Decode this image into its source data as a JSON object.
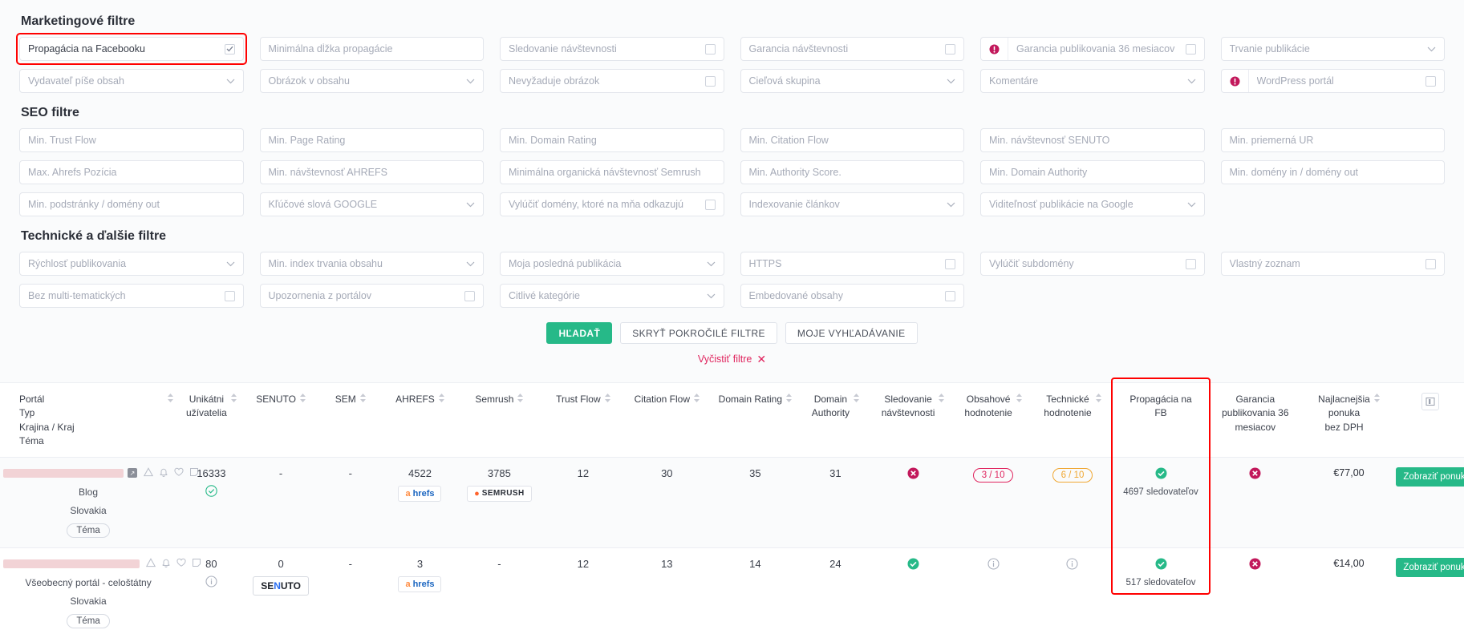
{
  "sections": {
    "marketing": {
      "title": "Marketingové filtre",
      "rows": [
        [
          {
            "name": "propagacia-na-facebooku",
            "label": "Propagácia na Facebooku",
            "type": "checkbox",
            "checked": true,
            "filled": true,
            "highlight": true
          },
          {
            "name": "minimalna-dlzka-propagacie",
            "label": "Minimálna dĺžka propagácie",
            "type": "text"
          },
          {
            "name": "sledovanie-navstevnosti",
            "label": "Sledovanie návštevnosti",
            "type": "checkbox",
            "checked": false
          },
          {
            "name": "garancia-navstevnosti",
            "label": "Garancia návštevnosti",
            "type": "checkbox",
            "checked": false
          },
          {
            "name": "garancia-publikovania-36-mesiacov",
            "label": "Garancia publikovania 36 mesiacov",
            "type": "checkbox",
            "checked": false,
            "badge": "premium"
          },
          {
            "name": "trvanie-publikacie",
            "label": "Trvanie publikácie",
            "type": "select"
          }
        ],
        [
          {
            "name": "vydavatel-pise-obsah",
            "label": "Vydavateľ píše obsah",
            "type": "select"
          },
          {
            "name": "obrazok-v-obsahu",
            "label": "Obrázok v obsahu",
            "type": "select"
          },
          {
            "name": "nevyzaduje-obrazok",
            "label": "Nevyžaduje obrázok",
            "type": "checkbox",
            "checked": false
          },
          {
            "name": "cielova-skupina",
            "label": "Cieľová skupina",
            "type": "select"
          },
          {
            "name": "komentare",
            "label": "Komentáre",
            "type": "select"
          },
          {
            "name": "wordpress-portal",
            "label": "WordPress portál",
            "type": "checkbox",
            "checked": false,
            "badge": "premium"
          }
        ]
      ]
    },
    "seo": {
      "title": "SEO filtre",
      "rows": [
        [
          {
            "name": "min-trust-flow",
            "label": "Min. Trust Flow",
            "type": "text"
          },
          {
            "name": "min-page-rating",
            "label": "Min. Page Rating",
            "type": "text"
          },
          {
            "name": "min-domain-rating",
            "label": "Min. Domain Rating",
            "type": "text"
          },
          {
            "name": "min-citation-flow",
            "label": "Min. Citation Flow",
            "type": "text"
          },
          {
            "name": "min-navstevnost-senuto",
            "label": "Min. návštevnosť SENUTO",
            "type": "text"
          },
          {
            "name": "min-priemerna-ur",
            "label": "Min. priemerná UR",
            "type": "text"
          }
        ],
        [
          {
            "name": "max-ahrefs-pozicia",
            "label": "Max. Ahrefs Pozícia",
            "type": "text"
          },
          {
            "name": "min-navstevnost-ahrefs",
            "label": "Min. návštevnosť AHREFS",
            "type": "text"
          },
          {
            "name": "minimalna-organicka-navstevnost-semrush",
            "label": "Minimálna organická návštevnosť Semrush",
            "type": "text"
          },
          {
            "name": "min-authority-score",
            "label": "Min. Authority Score.",
            "type": "text"
          },
          {
            "name": "min-domain-authority",
            "label": "Min. Domain Authority",
            "type": "text"
          },
          {
            "name": "min-domeny-in-domeny-out",
            "label": "Min. domény in / domény out",
            "type": "text"
          }
        ],
        [
          {
            "name": "min-podstranky-domeny-out",
            "label": "Min. podstránky / domény out",
            "type": "text"
          },
          {
            "name": "klucove-slova-google",
            "label": "Kľúčové slová GOOGLE",
            "type": "select"
          },
          {
            "name": "vylucit-domeny-ktore-na-mna-odkazuju",
            "label": "Vylúčiť domény, ktoré na mňa odkazujú",
            "type": "checkbox",
            "checked": false
          },
          {
            "name": "indexovanie-clankov",
            "label": "Indexovanie článkov",
            "type": "select"
          },
          {
            "name": "viditelnost-publikacie-na-google",
            "label": "Viditeľnosť publikácie na Google",
            "type": "select"
          },
          {
            "name": "seo-empty",
            "label": "",
            "type": "empty"
          }
        ]
      ]
    },
    "technical": {
      "title": "Technické a ďalšie filtre",
      "rows": [
        [
          {
            "name": "rychlost-publikovania",
            "label": "Rýchlosť publikovania",
            "type": "select"
          },
          {
            "name": "min-index-trvania-obsahu",
            "label": "Min. index trvania obsahu",
            "type": "select"
          },
          {
            "name": "moja-posledna-publikacia",
            "label": "Moja posledná publikácia",
            "type": "select"
          },
          {
            "name": "https",
            "label": "HTTPS",
            "type": "checkbox",
            "checked": false
          },
          {
            "name": "vylucit-subdomeny",
            "label": "Vylúčiť subdomény",
            "type": "checkbox",
            "checked": false
          },
          {
            "name": "vlastny-zoznam",
            "label": "Vlastný zoznam",
            "type": "checkbox",
            "checked": false
          }
        ],
        [
          {
            "name": "bez-multi-tematickych",
            "label": "Bez multi-tematických",
            "type": "checkbox",
            "checked": false
          },
          {
            "name": "upozornenia-z-portalov",
            "label": "Upozornenia z portálov",
            "type": "checkbox",
            "checked": false
          },
          {
            "name": "citlive-kategorie",
            "label": "Citlivé kategórie",
            "type": "select"
          },
          {
            "name": "embedovane-obsahy",
            "label": "Embedované obsahy",
            "type": "checkbox",
            "checked": false
          },
          {
            "name": "tech-empty-1",
            "label": "",
            "type": "empty"
          },
          {
            "name": "tech-empty-2",
            "label": "",
            "type": "empty"
          }
        ]
      ]
    }
  },
  "actions": {
    "search": "HĽADAŤ",
    "hide_advanced": "SKRYŤ POKROČILÉ FILTRE",
    "my_search": "MOJE VYHĽADÁVANIE",
    "clear_filters": "Vyčistiť filtre",
    "clear_icon": "close-x-icon"
  },
  "table": {
    "columns": [
      {
        "name": "portal",
        "lines": [
          "Portál",
          "Typ",
          "Krajina / Kraj",
          "Téma"
        ],
        "sortable": true,
        "align": "left"
      },
      {
        "name": "unikatni-uzivatelia",
        "lines": [
          "Unikátni",
          "užívatelia"
        ],
        "sortable": true
      },
      {
        "name": "senuto",
        "lines": [
          "SENUTO"
        ],
        "sortable": true
      },
      {
        "name": "sem",
        "lines": [
          "SEM"
        ],
        "sortable": true
      },
      {
        "name": "ahrefs",
        "lines": [
          "AHREFS"
        ],
        "sortable": true
      },
      {
        "name": "semrush",
        "lines": [
          "Semrush"
        ],
        "sortable": true
      },
      {
        "name": "trust-flow",
        "lines": [
          "Trust Flow"
        ],
        "sortable": true
      },
      {
        "name": "citation-flow",
        "lines": [
          "Citation Flow"
        ],
        "sortable": true
      },
      {
        "name": "domain-rating",
        "lines": [
          "Domain Rating"
        ],
        "sortable": true
      },
      {
        "name": "domain-authority",
        "lines": [
          "Domain",
          "Authority"
        ],
        "sortable": true
      },
      {
        "name": "sledovanie-navstevnosti",
        "lines": [
          "Sledovanie",
          "návštevnosti"
        ],
        "sortable": true
      },
      {
        "name": "obsahove-hodnotenie",
        "lines": [
          "Obsahové",
          "hodnotenie"
        ],
        "sortable": true
      },
      {
        "name": "technicke-hodnotenie",
        "lines": [
          "Technické",
          "hodnotenie"
        ],
        "sortable": true
      },
      {
        "name": "propagacia-na-fb",
        "lines": [
          "Propagácia na",
          "FB"
        ],
        "sortable": false
      },
      {
        "name": "garancia-publikovania-36-mesiacov",
        "lines": [
          "Garancia",
          "publikovania 36",
          "mesiacov"
        ],
        "sortable": false
      },
      {
        "name": "najlacnejsia-ponuka",
        "lines": [
          "Najlacnejšia",
          "ponuka",
          "bez DPH"
        ],
        "sortable": true
      },
      {
        "name": "column-settings",
        "lines": [
          ""
        ],
        "sortable": false
      }
    ],
    "rows": [
      {
        "portal_name_redacted": true,
        "type": "Blog",
        "country": "Slovakia",
        "tag": "Téma",
        "unique_users": "16333",
        "unique_users_status": "check",
        "senuto": "-",
        "senuto_badge": null,
        "sem": "-",
        "ahrefs": "4522",
        "ahrefs_badge": "ahrefs",
        "semrush": "3785",
        "semrush_badge": "SEMRUSH",
        "trust_flow": "12",
        "citation_flow": "30",
        "domain_rating": "35",
        "domain_authority": "31",
        "traffic_tracking": "cross",
        "content_score": "3 / 10",
        "content_score_style": "pink",
        "technical_score": "6 / 10",
        "technical_score_style": "amber",
        "fb_promo": "check",
        "fb_followers": "4697 sledovateľov",
        "publish_guarantee": "cross",
        "price": "€77,00",
        "offer_button": "Zobraziť ponuky"
      },
      {
        "portal_name_redacted": true,
        "type": "Všeobecný portál - celoštátny",
        "country": "Slovakia",
        "tag": "Téma",
        "unique_users": "80",
        "unique_users_status": "info",
        "senuto": "0",
        "senuto_badge": "SENUTO",
        "sem": "-",
        "ahrefs": "3",
        "ahrefs_badge": "ahrefs",
        "semrush": "-",
        "semrush_badge": null,
        "trust_flow": "12",
        "citation_flow": "13",
        "domain_rating": "14",
        "domain_authority": "24",
        "traffic_tracking": "check",
        "content_score": "info",
        "content_score_style": "icon",
        "technical_score": "info",
        "technical_score_style": "icon",
        "fb_promo": "check",
        "fb_followers": "517 sledovateľov",
        "publish_guarantee": "cross",
        "price": "€14,00",
        "offer_button": "Zobraziť ponuky"
      }
    ]
  },
  "colors": {
    "accent_green": "#26b988",
    "danger_red": "#c2185b",
    "highlight_red": "#ff0000",
    "pink": "#e0245e",
    "amber": "#f0a732"
  }
}
